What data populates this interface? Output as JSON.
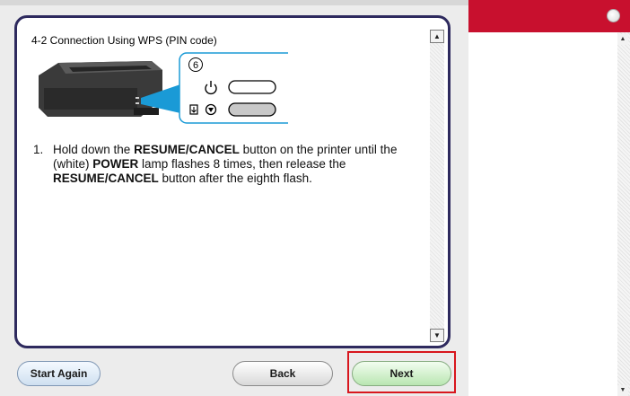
{
  "dialog": {
    "title": "4-2 Connection Using WPS (PIN code)",
    "illustration": {
      "step_badge": "6",
      "icons": [
        "power-icon",
        "wifi-icon",
        "stop-reset-icon"
      ]
    },
    "step": {
      "number": "1.",
      "t1": "Hold down the ",
      "b1": "RESUME/CANCEL",
      "t2": " button on the printer until the (white) ",
      "b2": "POWER",
      "t3": " lamp flashes 8 times, then release the ",
      "b3": "RESUME/CANCEL",
      "t4": " button after the eighth flash."
    },
    "scroll_up_icon": "▲",
    "scroll_down_icon": "▼"
  },
  "buttons": {
    "start_again": "Start Again",
    "back": "Back",
    "next": "Next"
  },
  "colors": {
    "panel_border": "#2e2a5e",
    "highlight": "#d8171e",
    "brand_bar": "#c8102e",
    "callout": "#1a9ad6"
  },
  "right_scroll": {
    "up": "▲",
    "down": "▼"
  }
}
